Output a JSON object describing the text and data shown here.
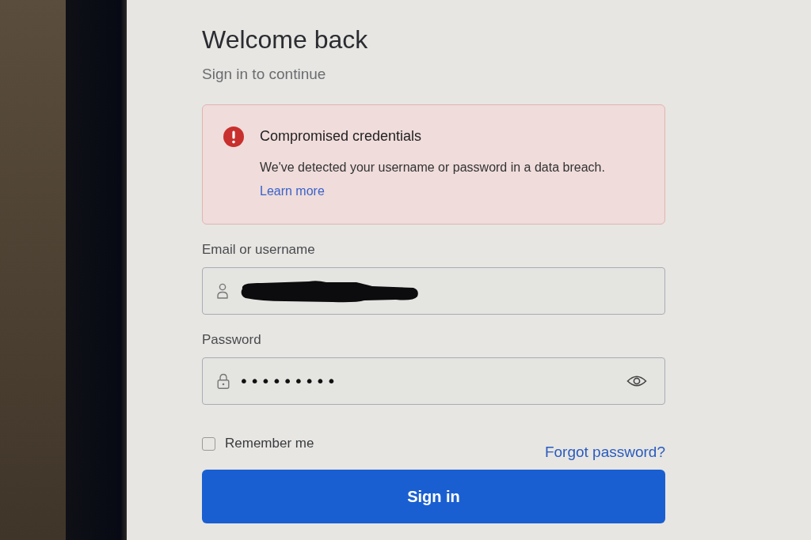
{
  "page": {
    "title": "Welcome back",
    "subtitle": "Sign in to continue"
  },
  "alert": {
    "kind": "error",
    "title": "Compromised credentials",
    "message": "We've detected your username or password in a data breach.",
    "link": "Learn more"
  },
  "fields": [
    {
      "kind": "email",
      "label": "Email or username",
      "redacted": true
    },
    {
      "kind": "password",
      "label": "Password",
      "value": "•••••••••",
      "reveal_toggle": true
    }
  ],
  "remember": {
    "label": "Remember me",
    "checked": false
  },
  "forgot_link": "Forgot password?",
  "submit": "Sign in"
}
